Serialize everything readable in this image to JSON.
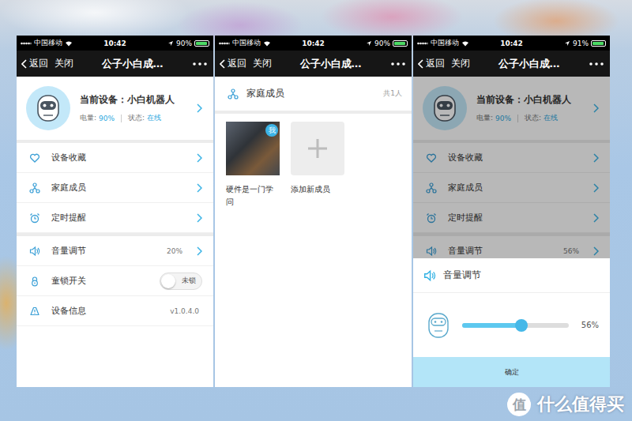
{
  "screens": [
    {
      "kind": "device",
      "status_bar": {
        "carrier": "中国移动",
        "time": "10:42",
        "battery": "90%",
        "battery_level": 0.9
      },
      "nav": {
        "back": "返回",
        "close": "关闭",
        "title": "公子小白成…"
      },
      "device_card": {
        "name": "当前设备：小白机器人",
        "battery_label": "电量:",
        "battery_value": "90%",
        "status_label": "状态:",
        "status_value": "在线"
      },
      "groups": [
        [
          {
            "kind": "link",
            "label": "设备收藏"
          },
          {
            "kind": "link",
            "label": "家庭成员"
          },
          {
            "kind": "link",
            "label": "定时提醒"
          }
        ],
        [
          {
            "kind": "link",
            "label": "音量调节",
            "value": "20%"
          },
          {
            "kind": "toggle",
            "label": "童锁开关",
            "toggle_text": "未锁",
            "on": false
          },
          {
            "kind": "info",
            "label": "设备信息",
            "value": "v1.0.4.0"
          }
        ]
      ]
    },
    {
      "kind": "members",
      "status_bar": {
        "carrier": "中国移动",
        "time": "10:42",
        "battery": "90%",
        "battery_level": 0.9
      },
      "nav": {
        "back": "返回",
        "close": "关闭",
        "title": "公子小白成…"
      },
      "section": {
        "title": "家庭成员",
        "count": "共1人"
      },
      "members": [
        {
          "kind": "member",
          "name": "硬件是一门学问",
          "badge": "我"
        },
        {
          "kind": "add",
          "name": "添加新成员"
        }
      ]
    },
    {
      "kind": "device_sheet",
      "status_bar": {
        "carrier": "中国移动",
        "time": "10:42",
        "battery": "91%",
        "battery_level": 0.91
      },
      "nav": {
        "back": "返回",
        "close": "关闭",
        "title": "公子小白成…"
      },
      "device_card": {
        "name": "当前设备：小白机器人",
        "battery_label": "电量:",
        "battery_value": "90%",
        "status_label": "状态:",
        "status_value": "在线"
      },
      "groups": [
        [
          {
            "kind": "link",
            "label": "设备收藏"
          },
          {
            "kind": "link",
            "label": "家庭成员"
          },
          {
            "kind": "link",
            "label": "定时提醒"
          }
        ],
        [
          {
            "kind": "link",
            "label": "音量调节",
            "value": "56%"
          }
        ]
      ],
      "sheet": {
        "title": "音量调节",
        "level": 0.56,
        "reading": "56%",
        "button": "确定"
      }
    }
  ],
  "watermark": {
    "logo": "值",
    "text": "什么值得买"
  }
}
